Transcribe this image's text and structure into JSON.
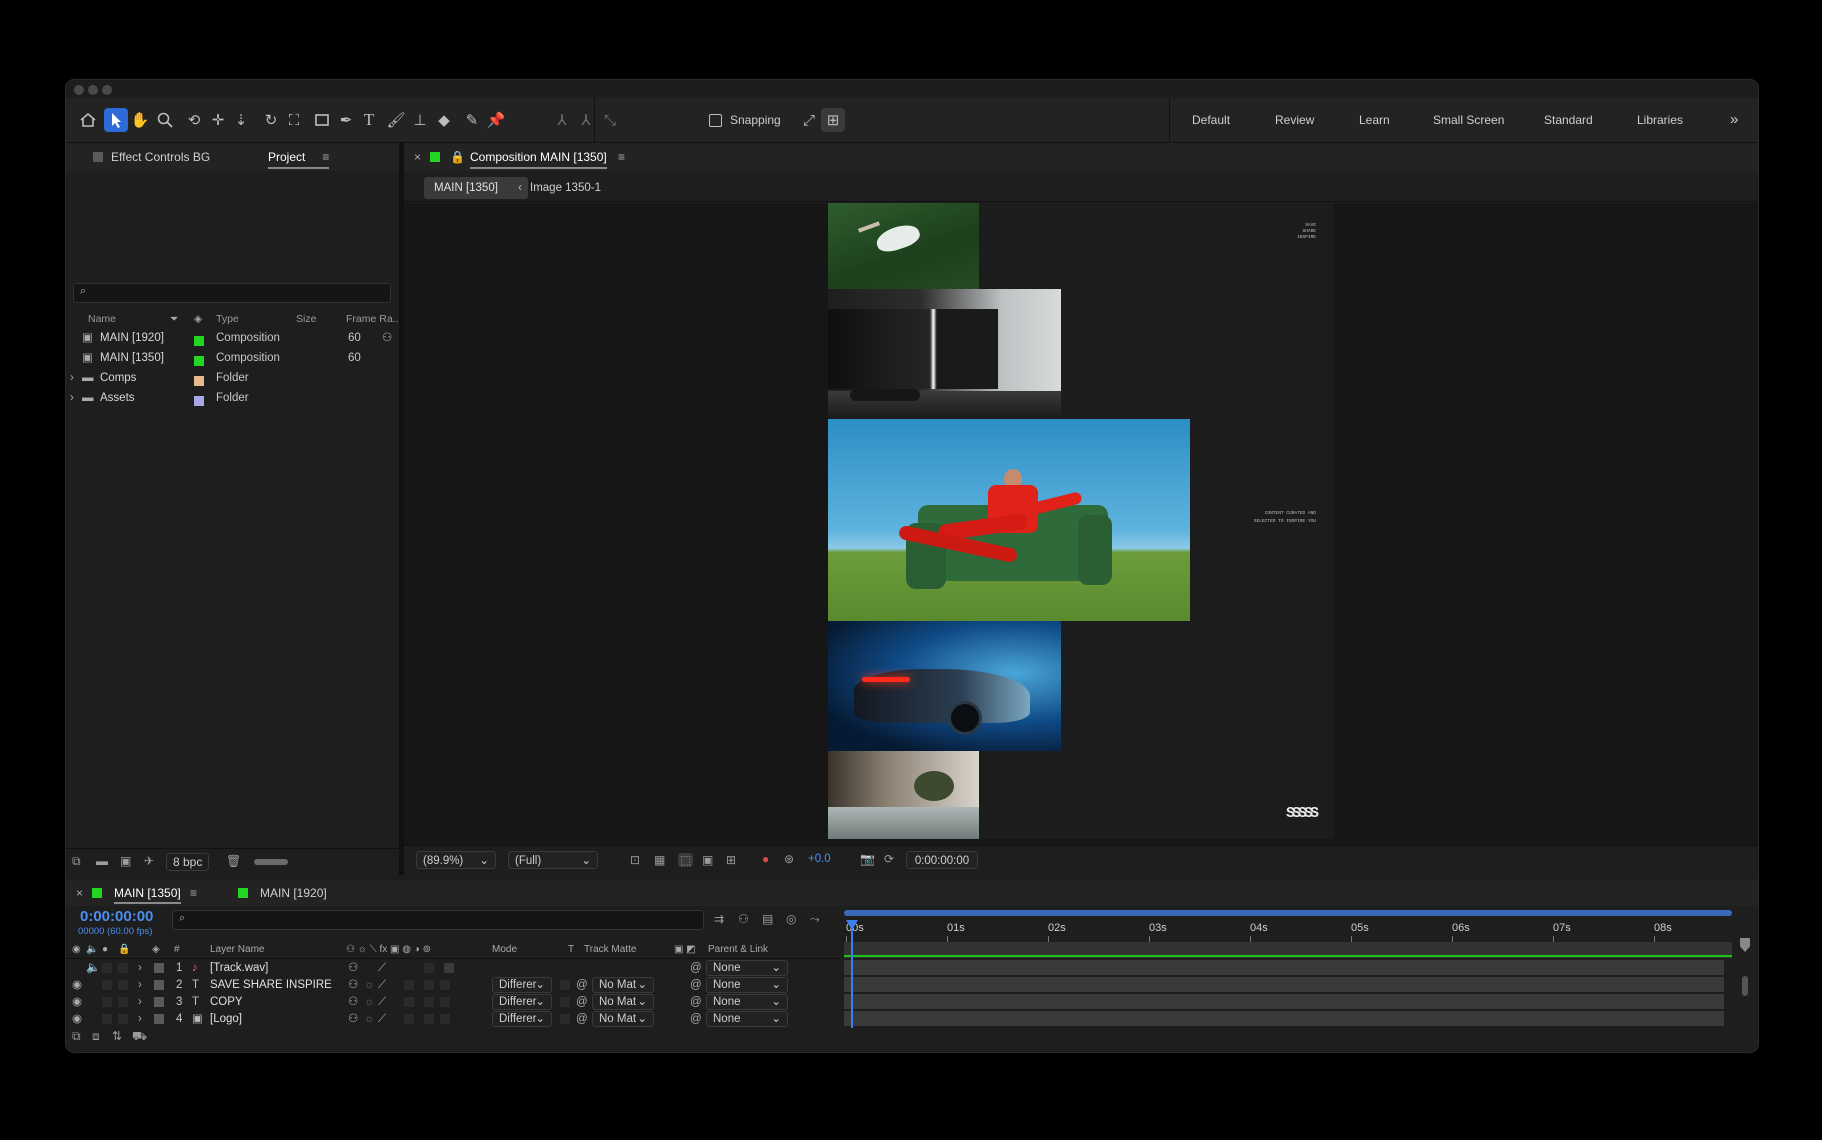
{
  "toolbar": {
    "snapping_label": "Snapping",
    "workspaces": [
      "Default",
      "Review",
      "Learn",
      "Small Screen",
      "Standard",
      "Libraries"
    ],
    "more_glyph": "»"
  },
  "project_panel": {
    "tabs": {
      "effect_controls": "Effect Controls BG",
      "project": "Project"
    },
    "columns": {
      "name": "Name",
      "type": "Type",
      "size": "Size",
      "frame_rate": "Frame Ra.."
    },
    "items": [
      {
        "name": "MAIN [1920]",
        "type": "Composition",
        "frame_rate": "60",
        "label_color": "#22d622"
      },
      {
        "name": "MAIN [1350]",
        "type": "Composition",
        "frame_rate": "60",
        "label_color": "#22d622"
      },
      {
        "name": "Comps",
        "type": "Folder",
        "label_color": "#e8b98a"
      },
      {
        "name": "Assets",
        "type": "Folder",
        "label_color": "#a7a7e6"
      }
    ],
    "bpc": "8 bpc"
  },
  "composition_panel": {
    "tab_title": "Composition MAIN [1350]",
    "breadcrumbs": [
      "MAIN [1350]",
      "Image 1350-1"
    ],
    "canvas_text": {
      "top_right": [
        "SAVE",
        "SHARE",
        "INSPIRE"
      ],
      "middle_right": [
        "CONTENT CURATED AND",
        "SELECTED TO INSPIRE YOU"
      ],
      "logo": "SSSSS"
    },
    "zoom": "(89.9%)",
    "resolution": "(Full)",
    "exposure": "+0.0",
    "timecode": "0:00:00:00"
  },
  "timeline": {
    "tabs": [
      "MAIN [1350]",
      "MAIN [1920]"
    ],
    "current_time": "0:00:00:00",
    "fps_info": "00000 (60.00 fps)",
    "columns": {
      "num": "#",
      "layer_name": "Layer Name",
      "mode": "Mode",
      "t": "T",
      "track_matte": "Track Matte",
      "parent": "Parent & Link"
    },
    "ruler": [
      "00s",
      "01s",
      "02s",
      "03s",
      "04s",
      "05s",
      "06s",
      "07s",
      "08s"
    ],
    "layers": [
      {
        "num": "1",
        "name": "[Track.wav]",
        "mode": "",
        "matte": "",
        "parent": "None",
        "type_glyph": "♪"
      },
      {
        "num": "2",
        "name": "SAVE SHARE INSPIRE",
        "mode": "Differer",
        "matte": "No Mat",
        "parent": "None",
        "type_glyph": "T"
      },
      {
        "num": "3",
        "name": "COPY",
        "mode": "Differer",
        "matte": "No Mat",
        "parent": "None",
        "type_glyph": "T"
      },
      {
        "num": "4",
        "name": "[Logo]",
        "mode": "Differer",
        "matte": "No Mat",
        "parent": "None",
        "type_glyph": "▣"
      }
    ]
  }
}
